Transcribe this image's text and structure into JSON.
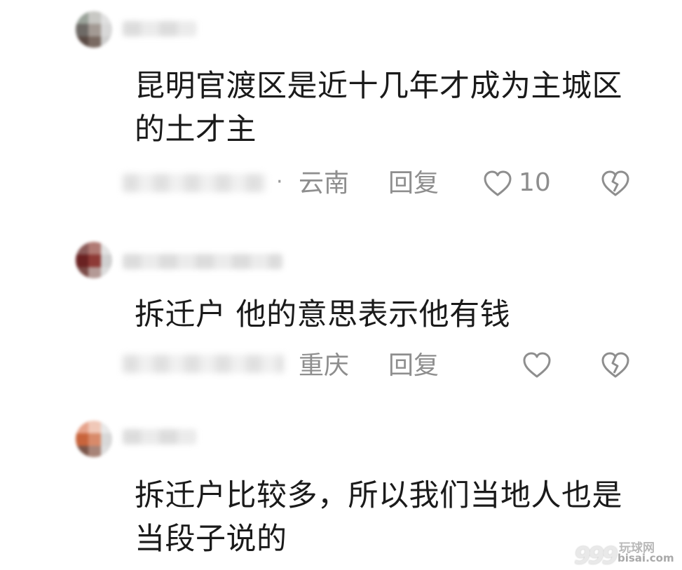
{
  "comments": [
    {
      "text": "昆明官渡区是近十几年才成为主城区的土才主",
      "location": "云南",
      "reply_label": "回复",
      "like_count": "10"
    },
    {
      "text": "拆迁户 他的意思表示他有钱",
      "location": "重庆",
      "reply_label": "回复",
      "like_count": ""
    },
    {
      "text": "拆迁户比较多，所以我们当地人也是当段子说的",
      "location": "",
      "reply_label": "",
      "like_count": ""
    }
  ],
  "separator": "·",
  "icons": {
    "like": "heart-outline-icon",
    "dislike": "broken-heart-icon"
  },
  "colors": {
    "text": "#1a1a1a",
    "meta": "#8e8e8e"
  },
  "watermark": {
    "number": "999",
    "cn": "玩球网",
    "en": "bisai.com"
  }
}
